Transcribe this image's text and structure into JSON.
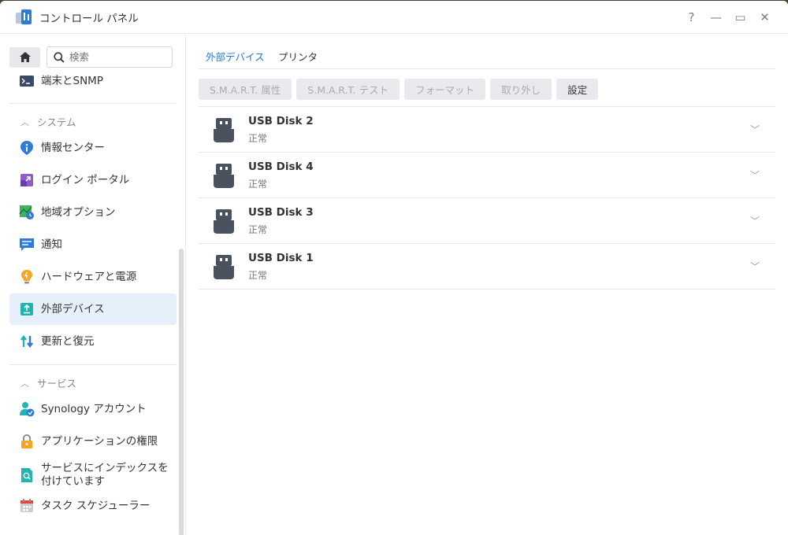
{
  "window": {
    "title": "コントロール パネル",
    "controls": {
      "help": "?",
      "minimize": "—",
      "maximize": "▭",
      "close": "✕"
    }
  },
  "sidebar": {
    "search_placeholder": "検索",
    "top_item": "端末とSNMP",
    "section_system": "システム",
    "system_items": [
      {
        "label": "情報センター",
        "icon": "info-icon"
      },
      {
        "label": "ログイン ポータル",
        "icon": "login-portal-icon"
      },
      {
        "label": "地域オプション",
        "icon": "regional-options-icon"
      },
      {
        "label": "通知",
        "icon": "notification-icon"
      },
      {
        "label": "ハードウェアと電源",
        "icon": "hardware-power-icon"
      },
      {
        "label": "外部デバイス",
        "icon": "external-devices-icon",
        "active": true
      },
      {
        "label": "更新と復元",
        "icon": "update-restore-icon"
      }
    ],
    "section_services": "サービス",
    "service_items": [
      {
        "label": "Synology アカウント",
        "icon": "synology-account-icon"
      },
      {
        "label": "アプリケーションの権限",
        "icon": "lock-icon"
      },
      {
        "label": "サービスにインデックスを付けています",
        "line1": "サービスにインデックスを",
        "line2": "付けています",
        "icon": "indexing-service-icon"
      },
      {
        "label": "タスク スケジューラー",
        "icon": "task-scheduler-icon"
      }
    ]
  },
  "main": {
    "tabs": [
      {
        "label": "外部デバイス",
        "active": true
      },
      {
        "label": "プリンタ",
        "active": false
      }
    ],
    "toolbar": [
      {
        "label": "S.M.A.R.T. 属性",
        "enabled": false
      },
      {
        "label": "S.M.A.R.T. テスト",
        "enabled": false
      },
      {
        "label": "フォーマット",
        "enabled": false
      },
      {
        "label": "取り外し",
        "enabled": false
      },
      {
        "label": "設定",
        "enabled": true
      }
    ],
    "devices": [
      {
        "name": "USB Disk 2",
        "status": "正常"
      },
      {
        "name": "USB Disk 4",
        "status": "正常"
      },
      {
        "name": "USB Disk 3",
        "status": "正常"
      },
      {
        "name": "USB Disk 1",
        "status": "正常"
      }
    ]
  },
  "colors": {
    "accent": "#1f7ad6",
    "active_bg": "#e6f0fa"
  }
}
